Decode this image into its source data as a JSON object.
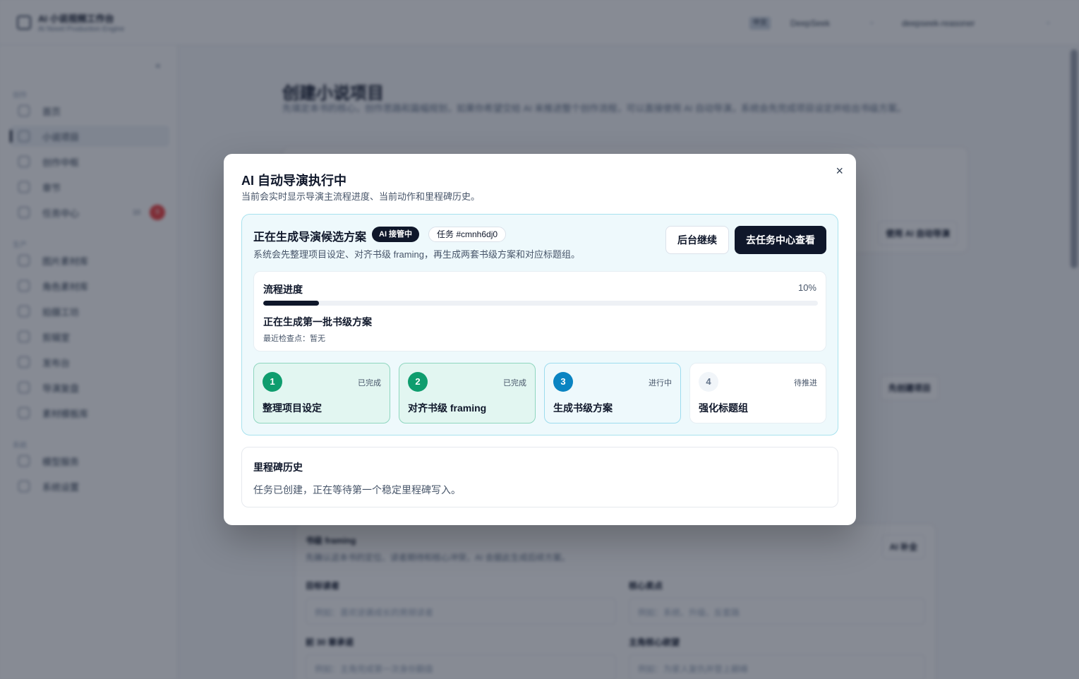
{
  "app": {
    "brand_title": "AI 小说视频工作台",
    "brand_sub": "AI Novel Production Engine",
    "lang_badge": "中文",
    "provider": "DeepSeek",
    "model": "deepseek-reasoner"
  },
  "sidebar": {
    "collapse_icon": "«",
    "sections": [
      "创作",
      "生产",
      "系统"
    ],
    "items": [
      {
        "label": "首页"
      },
      {
        "label": "小说项目"
      },
      {
        "label": "创作中枢"
      },
      {
        "label": "章节"
      },
      {
        "label": "任务中心",
        "count": "10",
        "dot": "9"
      },
      {
        "label": "图片素材库"
      },
      {
        "label": "角色素材库"
      },
      {
        "label": "拍摄工坊"
      },
      {
        "label": "剪辑室"
      },
      {
        "label": "发布台"
      },
      {
        "label": "导演复盘"
      },
      {
        "label": "素材模板库"
      },
      {
        "label": "模型服务"
      },
      {
        "label": "系统设置"
      }
    ]
  },
  "page": {
    "title": "创建小说项目",
    "desc": "先填定本书的核心，创作思路和篇幅规划，如果你希望交给 AI 来推进整个创作流程，可以直接使用 AI 自动导演，系统会先完成项目设定并给出书级方案。",
    "card_btn": "使用 AI 自动导演",
    "card_btn2": "先创建项目",
    "framing_title": "书级 framing",
    "framing_desc": "先确认这本书的定位、读者期待和核心冲突，AI 会据此生成后续方案。",
    "framing_btn": "AI 补全",
    "labels": [
      "目标读者",
      "核心卖点",
      "前 30 章承诺",
      "主角核心欲望"
    ],
    "placeholders": [
      "例如：喜欢逆袭成长的男频读者",
      "例如：系统、升级、反套路",
      "例如：主角完成第一次身份翻盘",
      "例如：为家人复仇并登上巅峰"
    ]
  },
  "modal": {
    "title": "AI 自动导演执行中",
    "subtitle": "当前会实时显示导演主流程进度、当前动作和里程碑历史。",
    "close_icon": "×",
    "panel": {
      "title": "正在生成导演候选方案",
      "badge_ai": "AI 接管中",
      "badge_task": "任务 #cmnh6dj0",
      "desc": "系统会先整理项目设定、对齐书级 framing，再生成两套书级方案和对应标题组。",
      "btn_background": "后台继续",
      "btn_task_center": "去任务中心查看"
    },
    "progress": {
      "label": "流程进度",
      "percent_text": "10%",
      "value": 0.1,
      "status": "正在生成第一批书级方案",
      "checkpoint": "最近检查点：暂无"
    },
    "steps": [
      {
        "num": "1",
        "name": "整理项目设定",
        "state": "已完成",
        "status": "done"
      },
      {
        "num": "2",
        "name": "对齐书级 framing",
        "state": "已完成",
        "status": "done"
      },
      {
        "num": "3",
        "name": "生成书级方案",
        "state": "进行中",
        "status": "active"
      },
      {
        "num": "4",
        "name": "强化标题组",
        "state": "待推进",
        "status": "todo"
      }
    ],
    "history": {
      "title": "里程碑历史",
      "text": "任务已创建，正在等待第一个稳定里程碑写入。"
    }
  },
  "colors": {
    "accent_dark": "#0f172a",
    "done_green": "#0f9d6e",
    "active_blue": "#0a84c2",
    "panel_bg": "#eef9fc"
  }
}
